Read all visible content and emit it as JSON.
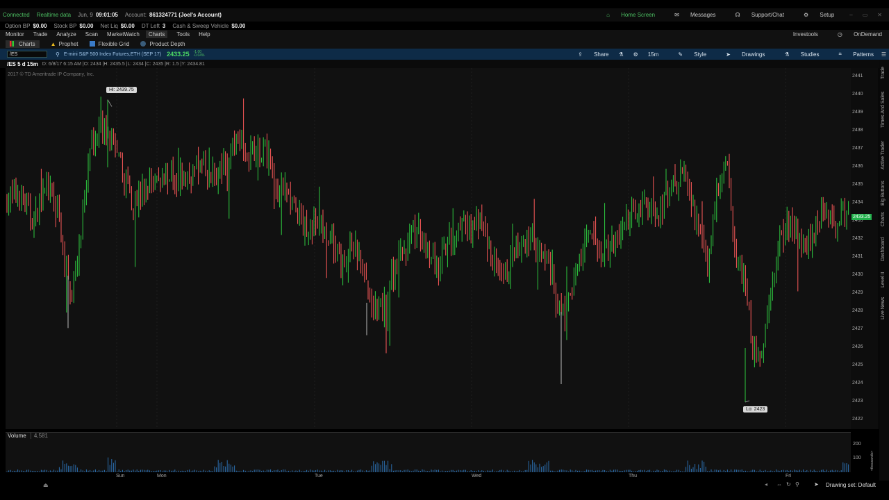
{
  "system": {
    "connected": "Connected",
    "realtime": "Realtime data",
    "date": "Jun, 9",
    "time": "09:01:05",
    "account_label": "Account:",
    "account": "861324771 (Joel's Account)",
    "home_screen": "Home Screen",
    "messages": "Messages",
    "support": "Support/Chat",
    "setup": "Setup"
  },
  "account_bar": {
    "option_bp_label": "Option BP",
    "option_bp": "$0.00",
    "stock_bp_label": "Stock BP",
    "stock_bp": "$0.00",
    "net_liq_label": "Net Liq",
    "net_liq": "$0.00",
    "dt_left_label": "DT Left",
    "dt_left": "3",
    "cash_label": "Cash & Sweep Vehicle",
    "cash": "$0.00"
  },
  "menu": {
    "items": [
      "Monitor",
      "Trade",
      "Analyze",
      "Scan",
      "MarketWatch",
      "Charts",
      "Tools",
      "Help"
    ],
    "investools": "Investools",
    "ondemand": "OnDemand"
  },
  "subtabs": {
    "charts": "Charts",
    "prophet": "Prophet",
    "flexible_grid": "Flexible Grid",
    "product_depth": "Product Depth"
  },
  "symbol_bar": {
    "symbol": "/ES",
    "description": "E-mini S&P 500 Index Futures,ETH (SEP 17)",
    "price": "2433.25",
    "change_line1": "-1.00",
    "change_line2": "-0.04%",
    "share": "Share",
    "timeframe": "15m",
    "style": "Style",
    "drawings": "Drawings",
    "studies": "Studies",
    "patterns": "Patterns"
  },
  "info_bar": {
    "chart_label": "/ES 5 d 15m",
    "ohlc": "D: 6/8/17 6:15 AM  |O: 2434  |H: 2435.5  |L: 2434  |C: 2435  |R: 1.5  |Y: 2434.81"
  },
  "chart": {
    "copyright": "2017 © TD Ameritrade IP Company, Inc.",
    "hi_label": "Hi: 2439.75",
    "lo_label": "Lo: 2423",
    "current_price_label": "2433.25",
    "volume_label": "Volume",
    "volume_value": "4,581",
    "volume_ticks": [
      "200",
      "100"
    ],
    "volume_unit": "<thousands>",
    "up_color": "#2ecc40",
    "down_color": "#ff5a5a",
    "price_tag_color": "#22b14c"
  },
  "status": {
    "drawing_set": "Drawing set: Default"
  },
  "right_rail": [
    "Trade",
    "Times And Sales",
    "Active Trader",
    "Big Buttons",
    "Charts",
    "Dashboard",
    "Level II",
    "Live News"
  ],
  "chart_data": {
    "type": "candlestick",
    "title": "/ES 5 d 15m",
    "ylim": [
      2421.5,
      2441.5
    ],
    "y_ticks": [
      2441,
      2440,
      2439,
      2438,
      2437,
      2436,
      2435,
      2434,
      2433,
      2432,
      2431,
      2430,
      2429,
      2428,
      2427,
      2426,
      2425,
      2424,
      2423,
      2422
    ],
    "x_day_labels": [
      "Sun",
      "Mon",
      "Tue",
      "Wed",
      "Thu",
      "Fri"
    ],
    "high": 2439.75,
    "low": 2423,
    "last": 2433.25,
    "series_path": [
      [
        0,
        2434.2
      ],
      [
        20,
        2434.5
      ],
      [
        40,
        2433.0
      ],
      [
        60,
        2434.8
      ],
      [
        75,
        2433.5
      ],
      [
        85,
        2430.5
      ],
      [
        95,
        2429.0
      ],
      [
        110,
        2432.8
      ],
      [
        125,
        2437.5
      ],
      [
        140,
        2438.2
      ],
      [
        155,
        2437.0
      ],
      [
        170,
        2435.6
      ],
      [
        185,
        2434.0
      ],
      [
        200,
        2434.8
      ],
      [
        230,
        2435.6
      ],
      [
        260,
        2435.4
      ],
      [
        280,
        2436.2
      ],
      [
        300,
        2435.5
      ],
      [
        320,
        2436.0
      ],
      [
        335,
        2437.8
      ],
      [
        350,
        2437.0
      ],
      [
        375,
        2436.8
      ],
      [
        395,
        2434.6
      ],
      [
        410,
        2434.4
      ],
      [
        430,
        2432.6
      ],
      [
        450,
        2432.8
      ],
      [
        470,
        2432.0
      ],
      [
        485,
        2430.5
      ],
      [
        500,
        2431.8
      ],
      [
        515,
        2430.2
      ],
      [
        530,
        2428.0
      ],
      [
        545,
        2428.2
      ],
      [
        560,
        2430.6
      ],
      [
        575,
        2431.5
      ],
      [
        590,
        2432.6
      ],
      [
        605,
        2431.8
      ],
      [
        620,
        2430.4
      ],
      [
        640,
        2431.8
      ],
      [
        660,
        2432.6
      ],
      [
        685,
        2432.9
      ],
      [
        700,
        2431.0
      ],
      [
        715,
        2429.5
      ],
      [
        730,
        2430.8
      ],
      [
        745,
        2431.6
      ],
      [
        760,
        2432.2
      ],
      [
        775,
        2431.4
      ],
      [
        790,
        2429.0
      ],
      [
        805,
        2427.6
      ],
      [
        820,
        2430.2
      ],
      [
        840,
        2432.1
      ],
      [
        860,
        2431.5
      ],
      [
        880,
        2431.9
      ],
      [
        900,
        2433.5
      ],
      [
        920,
        2434.1
      ],
      [
        940,
        2433.3
      ],
      [
        960,
        2435.0
      ],
      [
        975,
        2435.8
      ],
      [
        985,
        2434.0
      ],
      [
        1000,
        2432.6
      ],
      [
        1010,
        2430.2
      ],
      [
        1025,
        2434.8
      ],
      [
        1040,
        2436.0
      ],
      [
        1052,
        2431.0
      ],
      [
        1065,
        2429.5
      ],
      [
        1075,
        2426.0
      ],
      [
        1088,
        2425.3
      ],
      [
        1100,
        2428.6
      ],
      [
        1112,
        2431.7
      ],
      [
        1125,
        2433.1
      ],
      [
        1140,
        2432.2
      ],
      [
        1160,
        2432.0
      ],
      [
        1175,
        2433.7
      ],
      [
        1190,
        2433.0
      ],
      [
        1205,
        2433.5
      ],
      [
        1216,
        2433.25
      ]
    ],
    "volume": {
      "ylim": [
        0,
        250
      ],
      "y_ticks": [
        200,
        100
      ]
    }
  }
}
